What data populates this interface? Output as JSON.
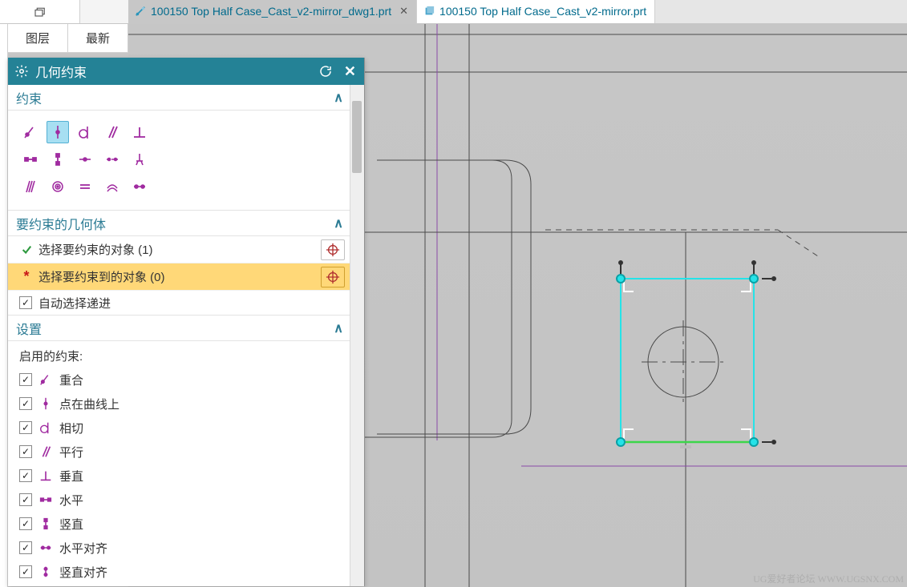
{
  "tabs": [
    {
      "label": "100150 Top Half Case_Cast_v2-mirror_dwg1.prt",
      "active": true
    },
    {
      "label": "100150 Top Half Case_Cast_v2-mirror.prt",
      "active": false
    }
  ],
  "ribbon": {
    "layers": "图层",
    "latest": "最新"
  },
  "dialog": {
    "title": "几何约束",
    "sections": {
      "constraint": "约束",
      "target_geom": "要约束的几何体",
      "settings": "设置"
    },
    "selection": {
      "row1": "选择要约束的对象 (1)",
      "row2": "选择要约束到的对象 (0)",
      "auto": "自动选择递进"
    },
    "settings_block": {
      "enabled_label": "启用的约束:",
      "items": [
        {
          "key": "coincident",
          "label": "重合",
          "glyph": "coinc"
        },
        {
          "key": "point_on_curve",
          "label": "点在曲线上",
          "glyph": "ptcurve"
        },
        {
          "key": "tangent",
          "label": "相切",
          "glyph": "tangent"
        },
        {
          "key": "parallel",
          "label": "平行",
          "glyph": "parallel"
        },
        {
          "key": "perpendicular",
          "label": "垂直",
          "glyph": "perp"
        },
        {
          "key": "horizontal",
          "label": "水平",
          "glyph": "horiz"
        },
        {
          "key": "vertical",
          "label": "竖直",
          "glyph": "vert"
        },
        {
          "key": "horiz_align",
          "label": "水平对齐",
          "glyph": "halign"
        },
        {
          "key": "vert_align",
          "label": "竖直对齐",
          "glyph": "valign"
        }
      ]
    },
    "toolgrid_selected_index": 1
  },
  "watermark": "UG爱好者论坛  WWW.UGSNX.COM"
}
